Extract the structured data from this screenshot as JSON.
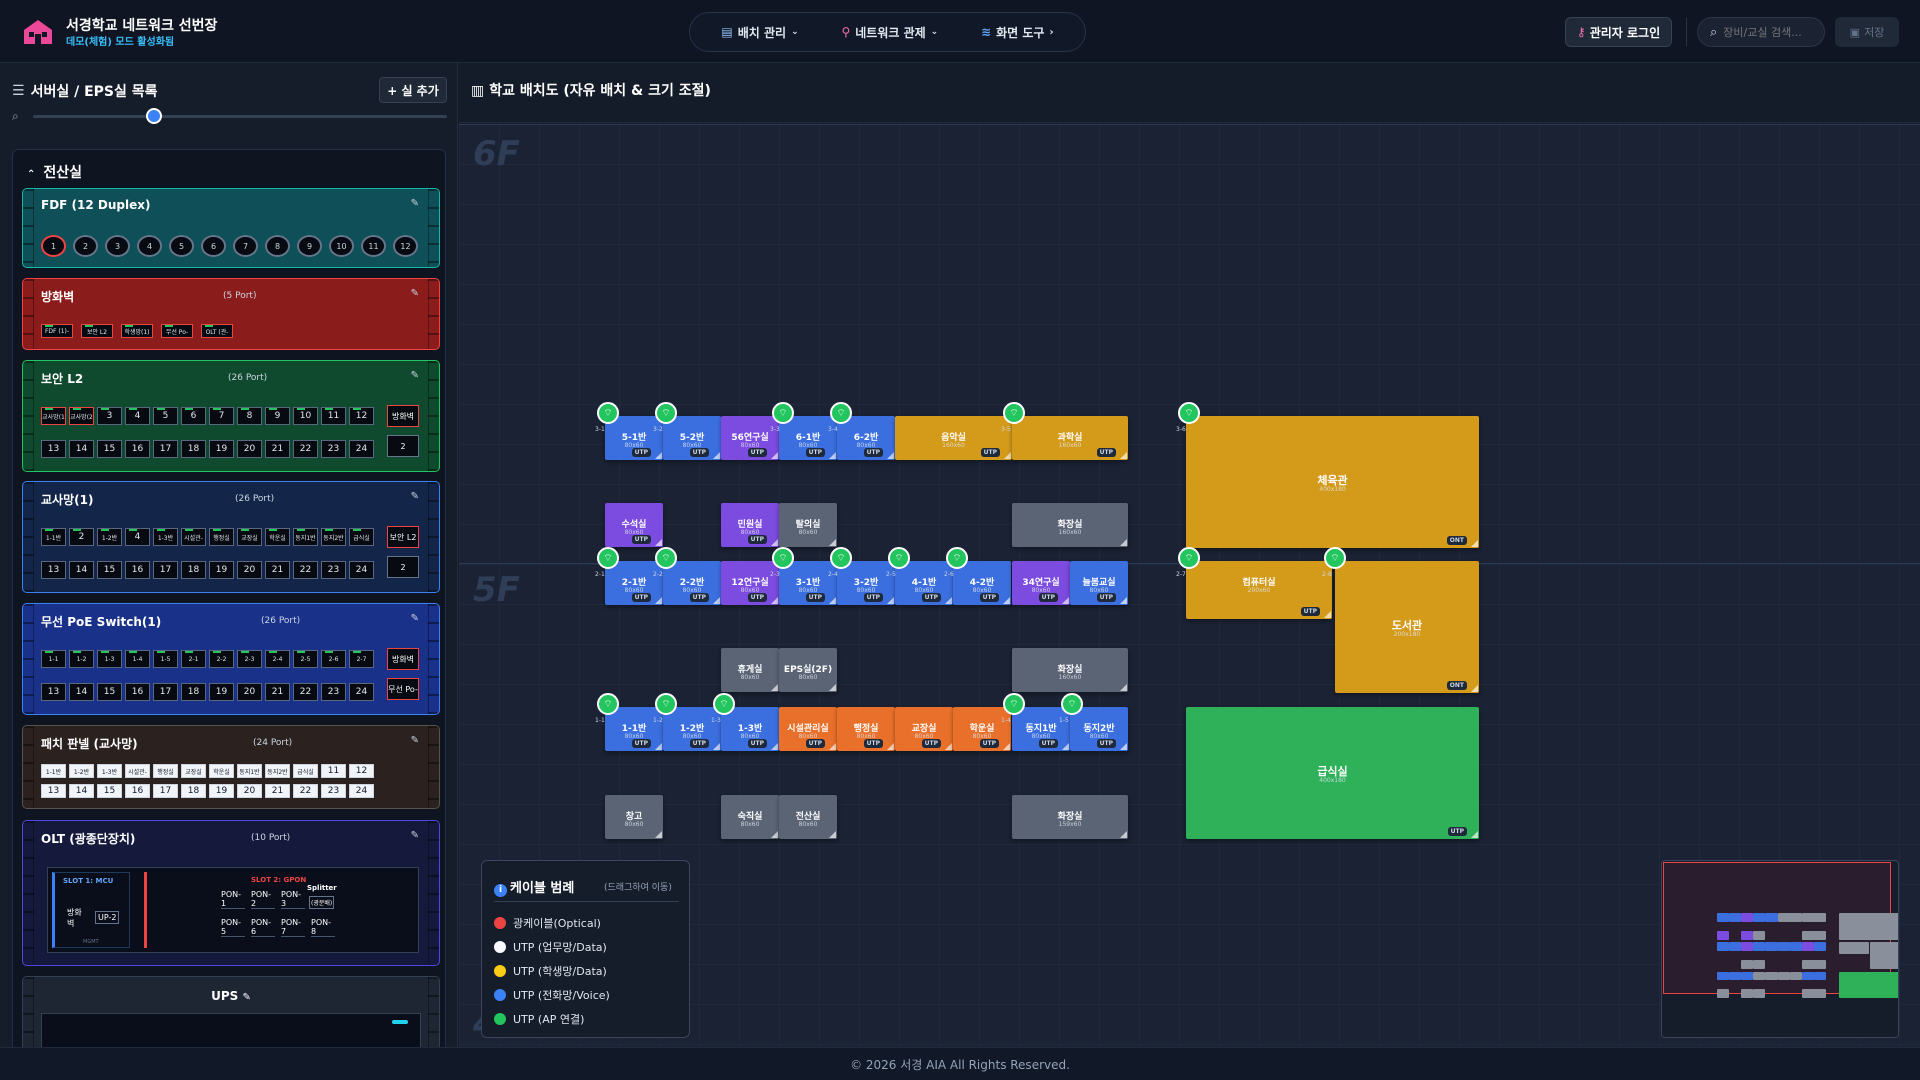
{
  "header": {
    "title": "서경학교 네트워크 선번장",
    "subtitle": "데모(체험) 모드 활성화됨",
    "nav": [
      "배치 관리",
      "네트워크 관제",
      "화면 도구"
    ],
    "admin": "관리자 로그인",
    "search_placeholder": "장비/교실 검색...",
    "save": "저장"
  },
  "sidebar": {
    "title": "서버실 / EPS실 목록",
    "add_room": "+ 실 추가",
    "room_name": "전산실",
    "fdf": {
      "name": "FDF (12 Duplex)",
      "ports": [
        "1",
        "2",
        "3",
        "4",
        "5",
        "6",
        "7",
        "8",
        "9",
        "10",
        "11",
        "12"
      ]
    },
    "firewall": {
      "name": "방화벽",
      "count": "(5 Port)",
      "ports": [
        "FDF (1)-",
        "보안 L2",
        "학생망(1)",
        "무선 Po-",
        "OLT (관-"
      ]
    },
    "l2": {
      "name": "보안 L2",
      "count": "(26 Port)",
      "row1": [
        "교사망(1",
        "교사망(2",
        "3",
        "4",
        "5",
        "6",
        "7",
        "8",
        "9",
        "10",
        "11",
        "12"
      ],
      "row2": [
        "13",
        "14",
        "15",
        "16",
        "17",
        "18",
        "19",
        "20",
        "21",
        "22",
        "23",
        "24"
      ],
      "side1": "방화벽",
      "side2": "2"
    },
    "teacher": {
      "name": "교사망(1)",
      "count": "(26 Port)",
      "row1": [
        "1-1반",
        "2",
        "1-2반",
        "4",
        "1-3반",
        "시설관-",
        "행정실",
        "교장실",
        "학운실",
        "동지1반",
        "동지2반",
        "급식실"
      ],
      "row2": [
        "13",
        "14",
        "15",
        "16",
        "17",
        "18",
        "19",
        "20",
        "21",
        "22",
        "23",
        "24"
      ],
      "side1": "보안 L2",
      "side2": "2"
    },
    "poe": {
      "name": "무선 PoE Switch(1)",
      "count": "(26 Port)",
      "row1": [
        "1-1",
        "1-2",
        "1-3",
        "1-4",
        "1-5",
        "2-1",
        "2-2",
        "2-3",
        "2-4",
        "2-5",
        "2-6",
        "2-7"
      ],
      "row2": [
        "13",
        "14",
        "15",
        "16",
        "17",
        "18",
        "19",
        "20",
        "21",
        "22",
        "23",
        "24"
      ],
      "side1": "방화벽",
      "side2": "무선 Po-"
    },
    "patch": {
      "name": "패치 판넬 (교사망)",
      "count": "(24 Port)",
      "row1": [
        "1-1반",
        "1-2반",
        "1-3반",
        "시설관-",
        "행정실",
        "교장실",
        "학운실",
        "동지1반",
        "동지2반",
        "급식실",
        "11",
        "12"
      ],
      "row2": [
        "13",
        "14",
        "15",
        "16",
        "17",
        "18",
        "19",
        "20",
        "21",
        "22",
        "23",
        "24"
      ]
    },
    "olt": {
      "name": "OLT (광종단장치)",
      "count": "(10 Port)",
      "slot1": "SLOT 1: MCU",
      "slot2": "SLOT 2: GPON",
      "up1": "방화벽",
      "up2": "UP-2",
      "mgmt": "MGMT",
      "pons": [
        "PON-1",
        "PON-2",
        "PON-3",
        "PON-5",
        "PON-6",
        "PON-7",
        "PON-8"
      ],
      "splitter": "Splitter",
      "splitter_sub": "(광분배)"
    },
    "ups": {
      "name": "UPS"
    }
  },
  "map": {
    "title": "학교 배치도 (자유 배치 & 크기 조절)",
    "floors": [
      "6F",
      "5F",
      "4F"
    ],
    "rooms": [
      {
        "n": "5-1반",
        "s": "80x60",
        "c": "blue",
        "u": "UTP"
      },
      {
        "n": "5-2반",
        "s": "80x60",
        "c": "blue",
        "u": "UTP"
      },
      {
        "n": "56연구실",
        "s": "80x60",
        "c": "purple",
        "u": "UTP"
      },
      {
        "n": "6-1반",
        "s": "80x60",
        "c": "blue",
        "u": "UTP"
      },
      {
        "n": "6-2반",
        "s": "80x60",
        "c": "blue",
        "u": "UTP"
      },
      {
        "n": "음악실",
        "s": "160x60",
        "c": "gold",
        "u": "UTP"
      },
      {
        "n": "과학실",
        "s": "160x60",
        "c": "gold",
        "u": "UTP"
      },
      {
        "n": "체육관",
        "s": "400x180",
        "c": "gold",
        "u": "ONT"
      },
      {
        "n": "수석실",
        "s": "80x60",
        "c": "purple",
        "u": "UTP"
      },
      {
        "n": "민원실",
        "s": "80x60",
        "c": "purple",
        "u": "UTP"
      },
      {
        "n": "탈의실",
        "s": "80x60",
        "c": "gray",
        "u": ""
      },
      {
        "n": "화장실",
        "s": "160x60",
        "c": "gray",
        "u": ""
      },
      {
        "n": "2-1반",
        "s": "80x60",
        "c": "blue",
        "u": "UTP"
      },
      {
        "n": "2-2반",
        "s": "80x60",
        "c": "blue",
        "u": "UTP"
      },
      {
        "n": "12연구실",
        "s": "80x60",
        "c": "purple",
        "u": "UTP"
      },
      {
        "n": "3-1반",
        "s": "80x60",
        "c": "blue",
        "u": "UTP"
      },
      {
        "n": "3-2반",
        "s": "80x60",
        "c": "blue",
        "u": "UTP"
      },
      {
        "n": "4-1반",
        "s": "80x60",
        "c": "blue",
        "u": "UTP"
      },
      {
        "n": "4-2반",
        "s": "80x60",
        "c": "blue",
        "u": "UTP"
      },
      {
        "n": "34연구실",
        "s": "80x60",
        "c": "purple",
        "u": "UTP"
      },
      {
        "n": "늘봄교실",
        "s": "80x60",
        "c": "blue",
        "u": "UTP"
      },
      {
        "n": "컴퓨터실",
        "s": "200x60",
        "c": "gold",
        "u": "UTP"
      },
      {
        "n": "도서관",
        "s": "200x180",
        "c": "gold",
        "u": "ONT"
      },
      {
        "n": "휴게실",
        "s": "80x60",
        "c": "gray",
        "u": ""
      },
      {
        "n": "EPS실(2F)",
        "s": "80x60",
        "c": "gray",
        "u": ""
      },
      {
        "n": "화장실",
        "s": "160x60",
        "c": "gray",
        "u": ""
      },
      {
        "n": "1-1반",
        "s": "80x60",
        "c": "blue",
        "u": "UTP"
      },
      {
        "n": "1-2반",
        "s": "80x60",
        "c": "blue",
        "u": "UTP"
      },
      {
        "n": "1-3반",
        "s": "80x60",
        "c": "blue",
        "u": "UTP"
      },
      {
        "n": "시설관리실",
        "s": "80x60",
        "c": "orange",
        "u": "UTP"
      },
      {
        "n": "행정실",
        "s": "80x60",
        "c": "orange",
        "u": "UTP"
      },
      {
        "n": "교장실",
        "s": "80x60",
        "c": "orange",
        "u": "UTP"
      },
      {
        "n": "학운실",
        "s": "80x60",
        "c": "orange",
        "u": "UTP"
      },
      {
        "n": "동지1반",
        "s": "80x60",
        "c": "blue",
        "u": "UTP"
      },
      {
        "n": "동지2반",
        "s": "80x60",
        "c": "blue",
        "u": "UTP"
      },
      {
        "n": "급식실",
        "s": "400x180",
        "c": "green",
        "u": "UTP"
      },
      {
        "n": "창고",
        "s": "80x60",
        "c": "gray",
        "u": ""
      },
      {
        "n": "숙직실",
        "s": "80x60",
        "c": "gray",
        "u": ""
      },
      {
        "n": "전산실",
        "s": "80x60",
        "c": "gray",
        "u": ""
      },
      {
        "n": "화장실",
        "s": "159x60",
        "c": "gray",
        "u": ""
      }
    ],
    "aps": [
      "3-1",
      "3-2",
      "3-3",
      "3-4",
      "3-5",
      "3-6",
      "2-1",
      "2-2",
      "2-3",
      "2-4",
      "2-5",
      "2-6",
      "2-7",
      "2-8",
      "1-1",
      "1-2",
      "1-3",
      "1-4",
      "1-5"
    ]
  },
  "legend": {
    "title": "케이블 범례",
    "drag": "(드래그하여 이동)",
    "items": [
      {
        "t": "광케이블(Optical)",
        "c": "#ef4444"
      },
      {
        "t": "UTP (업무망/Data)",
        "c": "#f8fafc"
      },
      {
        "t": "UTP (학생망/Data)",
        "c": "#facc15"
      },
      {
        "t": "UTP (전화망/Voice)",
        "c": "#3b82f6"
      },
      {
        "t": "UTP (AP 연결)",
        "c": "#22c55e"
      }
    ]
  },
  "footer": "© 2026 서경 AIA All Rights Reserved."
}
